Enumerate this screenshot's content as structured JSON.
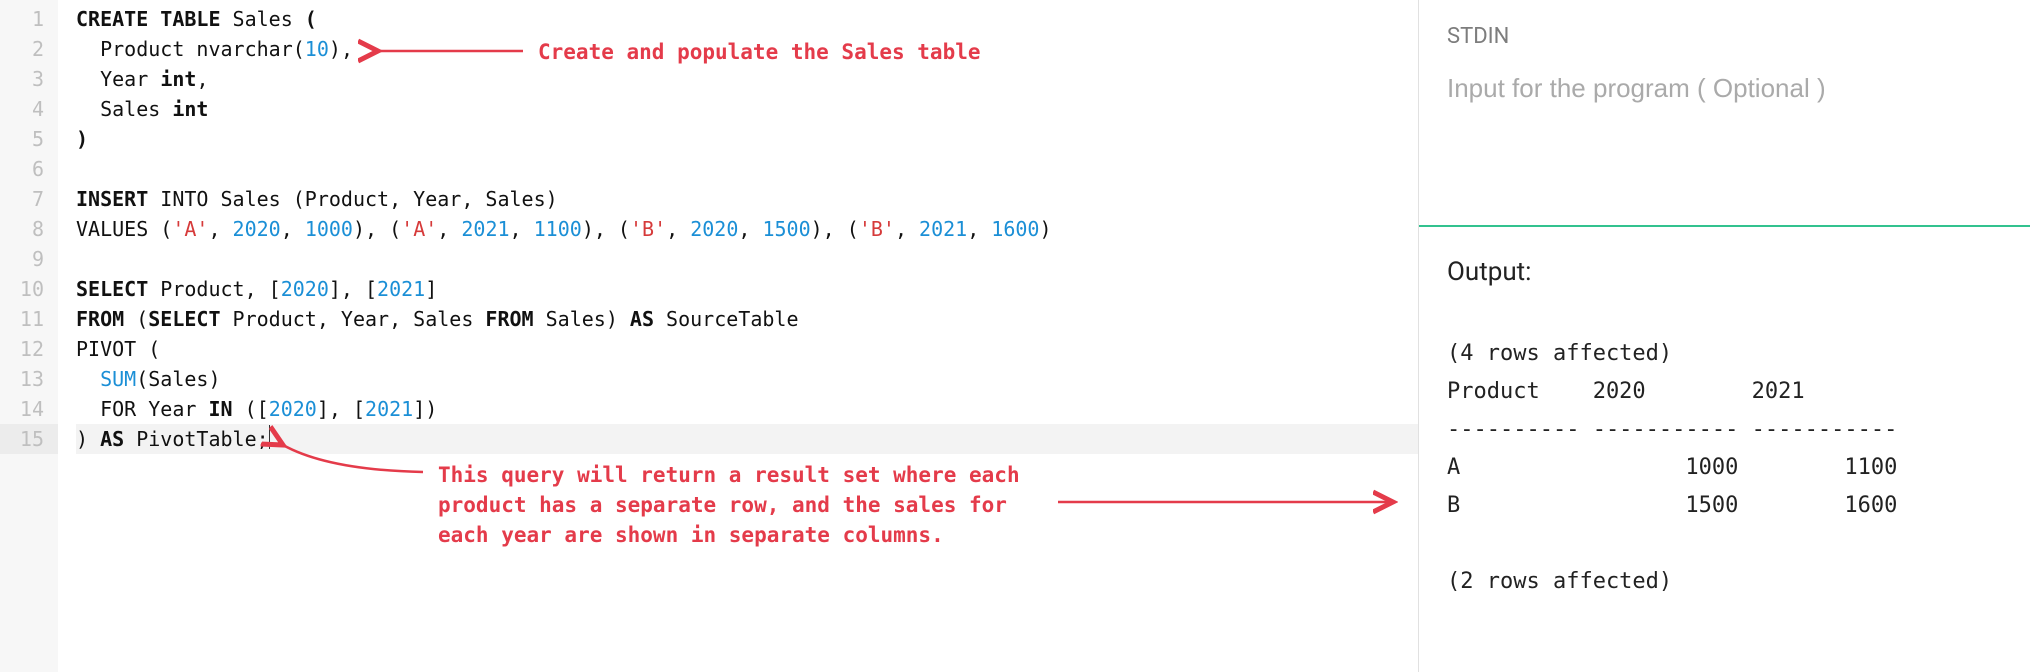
{
  "editor": {
    "line_count": 15,
    "active_line": 15,
    "lines": [
      {
        "tokens": [
          {
            "t": "CREATE TABLE",
            "c": "kw"
          },
          {
            "t": " Sales "
          },
          {
            "t": "(",
            "c": "paren-hl"
          }
        ]
      },
      {
        "indent": 1,
        "tokens": [
          {
            "t": "Product nvarchar"
          },
          {
            "t": "(",
            "c": "br"
          },
          {
            "t": "10",
            "c": "num"
          },
          {
            "t": ")",
            "c": "br"
          },
          {
            "t": ","
          }
        ]
      },
      {
        "indent": 1,
        "tokens": [
          {
            "t": "Year "
          },
          {
            "t": "int",
            "c": "kw"
          },
          {
            "t": ","
          }
        ]
      },
      {
        "indent": 1,
        "tokens": [
          {
            "t": "Sales "
          },
          {
            "t": "int",
            "c": "kw"
          }
        ]
      },
      {
        "tokens": [
          {
            "t": ")",
            "c": "paren-hl"
          }
        ]
      },
      {
        "tokens": []
      },
      {
        "tokens": [
          {
            "t": "INSERT",
            "c": "kw"
          },
          {
            "t": " INTO Sales (Product, Year, Sales)"
          }
        ]
      },
      {
        "tokens": [
          {
            "t": "VALUES ("
          },
          {
            "t": "'A'",
            "c": "str"
          },
          {
            "t": ", "
          },
          {
            "t": "2020",
            "c": "num"
          },
          {
            "t": ", "
          },
          {
            "t": "1000",
            "c": "num"
          },
          {
            "t": "), ("
          },
          {
            "t": "'A'",
            "c": "str"
          },
          {
            "t": ", "
          },
          {
            "t": "2021",
            "c": "num"
          },
          {
            "t": ", "
          },
          {
            "t": "1100",
            "c": "num"
          },
          {
            "t": "), ("
          },
          {
            "t": "'B'",
            "c": "str"
          },
          {
            "t": ", "
          },
          {
            "t": "2020",
            "c": "num"
          },
          {
            "t": ", "
          },
          {
            "t": "1500",
            "c": "num"
          },
          {
            "t": "), ("
          },
          {
            "t": "'B'",
            "c": "str"
          },
          {
            "t": ", "
          },
          {
            "t": "2021",
            "c": "num"
          },
          {
            "t": ", "
          },
          {
            "t": "1600",
            "c": "num"
          },
          {
            "t": ")"
          }
        ]
      },
      {
        "tokens": []
      },
      {
        "tokens": [
          {
            "t": "SELECT",
            "c": "kw"
          },
          {
            "t": " Product, ["
          },
          {
            "t": "2020",
            "c": "num"
          },
          {
            "t": "], ["
          },
          {
            "t": "2021",
            "c": "num"
          },
          {
            "t": "]"
          }
        ]
      },
      {
        "tokens": [
          {
            "t": "FROM",
            "c": "kw"
          },
          {
            "t": " ("
          },
          {
            "t": "SELECT",
            "c": "kw"
          },
          {
            "t": " Product, Year, Sales "
          },
          {
            "t": "FROM",
            "c": "kw"
          },
          {
            "t": " Sales) "
          },
          {
            "t": "AS",
            "c": "kw"
          },
          {
            "t": " SourceTable"
          }
        ]
      },
      {
        "tokens": [
          {
            "t": "PIVOT ("
          }
        ]
      },
      {
        "indent": 1,
        "tokens": [
          {
            "t": "SUM",
            "c": "fn"
          },
          {
            "t": "(Sales)"
          }
        ]
      },
      {
        "indent": 1,
        "tokens": [
          {
            "t": "FOR Year "
          },
          {
            "t": "IN",
            "c": "kw"
          },
          {
            "t": " (["
          },
          {
            "t": "2020",
            "c": "num"
          },
          {
            "t": "], ["
          },
          {
            "t": "2021",
            "c": "num"
          },
          {
            "t": "])"
          }
        ]
      },
      {
        "active": true,
        "tokens": [
          {
            "t": ") "
          },
          {
            "t": "AS",
            "c": "kw"
          },
          {
            "t": " PivotTable;"
          }
        ],
        "cursor_after": true
      }
    ]
  },
  "annotations": {
    "a1": "Create and populate the Sales table",
    "a2_l1": "This query will return a result set where each",
    "a2_l2": "product has a separate row, and the sales for",
    "a2_l3": "each year are shown in separate columns."
  },
  "io": {
    "stdin_label": "STDIN",
    "stdin_placeholder": "Input for the program ( Optional )",
    "stdin_value": "",
    "output_label": "Output:",
    "output_text": "(4 rows affected)\nProduct    2020        2021\n---------- ----------- -----------\nA                 1000        1100\nB                 1500        1600\n\n(2 rows affected)"
  }
}
